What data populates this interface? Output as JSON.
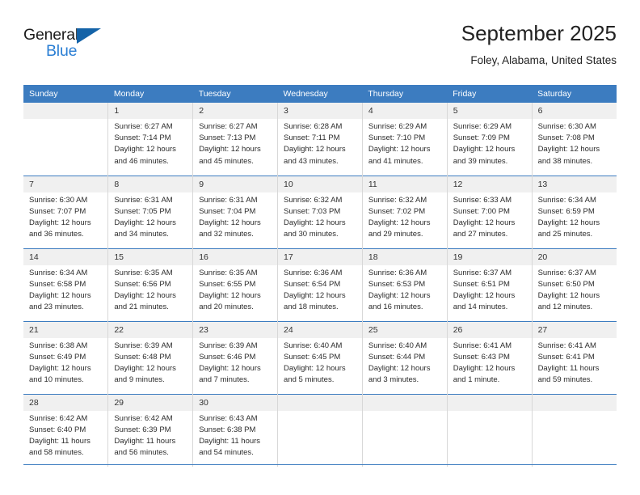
{
  "brand": {
    "name_top": "General",
    "name_bottom": "Blue",
    "logo_icon": "triangle-flag-icon",
    "color_dark": "#1b1b1b",
    "color_blue": "#2b7fd4",
    "color_triangle": "#1463a8"
  },
  "header": {
    "title": "September 2025",
    "subtitle": "Foley, Alabama, United States"
  },
  "theme": {
    "header_blue": "#3c7cc0",
    "daynum_band": "#f0f0f0",
    "text": "#2c2c2c"
  },
  "weekdays": [
    "Sunday",
    "Monday",
    "Tuesday",
    "Wednesday",
    "Thursday",
    "Friday",
    "Saturday"
  ],
  "weeks": [
    [
      {
        "day": "",
        "lines": []
      },
      {
        "day": "1",
        "lines": [
          "Sunrise: 6:27 AM",
          "Sunset: 7:14 PM",
          "Daylight: 12 hours",
          "and 46 minutes."
        ]
      },
      {
        "day": "2",
        "lines": [
          "Sunrise: 6:27 AM",
          "Sunset: 7:13 PM",
          "Daylight: 12 hours",
          "and 45 minutes."
        ]
      },
      {
        "day": "3",
        "lines": [
          "Sunrise: 6:28 AM",
          "Sunset: 7:11 PM",
          "Daylight: 12 hours",
          "and 43 minutes."
        ]
      },
      {
        "day": "4",
        "lines": [
          "Sunrise: 6:29 AM",
          "Sunset: 7:10 PM",
          "Daylight: 12 hours",
          "and 41 minutes."
        ]
      },
      {
        "day": "5",
        "lines": [
          "Sunrise: 6:29 AM",
          "Sunset: 7:09 PM",
          "Daylight: 12 hours",
          "and 39 minutes."
        ]
      },
      {
        "day": "6",
        "lines": [
          "Sunrise: 6:30 AM",
          "Sunset: 7:08 PM",
          "Daylight: 12 hours",
          "and 38 minutes."
        ]
      }
    ],
    [
      {
        "day": "7",
        "lines": [
          "Sunrise: 6:30 AM",
          "Sunset: 7:07 PM",
          "Daylight: 12 hours",
          "and 36 minutes."
        ]
      },
      {
        "day": "8",
        "lines": [
          "Sunrise: 6:31 AM",
          "Sunset: 7:05 PM",
          "Daylight: 12 hours",
          "and 34 minutes."
        ]
      },
      {
        "day": "9",
        "lines": [
          "Sunrise: 6:31 AM",
          "Sunset: 7:04 PM",
          "Daylight: 12 hours",
          "and 32 minutes."
        ]
      },
      {
        "day": "10",
        "lines": [
          "Sunrise: 6:32 AM",
          "Sunset: 7:03 PM",
          "Daylight: 12 hours",
          "and 30 minutes."
        ]
      },
      {
        "day": "11",
        "lines": [
          "Sunrise: 6:32 AM",
          "Sunset: 7:02 PM",
          "Daylight: 12 hours",
          "and 29 minutes."
        ]
      },
      {
        "day": "12",
        "lines": [
          "Sunrise: 6:33 AM",
          "Sunset: 7:00 PM",
          "Daylight: 12 hours",
          "and 27 minutes."
        ]
      },
      {
        "day": "13",
        "lines": [
          "Sunrise: 6:34 AM",
          "Sunset: 6:59 PM",
          "Daylight: 12 hours",
          "and 25 minutes."
        ]
      }
    ],
    [
      {
        "day": "14",
        "lines": [
          "Sunrise: 6:34 AM",
          "Sunset: 6:58 PM",
          "Daylight: 12 hours",
          "and 23 minutes."
        ]
      },
      {
        "day": "15",
        "lines": [
          "Sunrise: 6:35 AM",
          "Sunset: 6:56 PM",
          "Daylight: 12 hours",
          "and 21 minutes."
        ]
      },
      {
        "day": "16",
        "lines": [
          "Sunrise: 6:35 AM",
          "Sunset: 6:55 PM",
          "Daylight: 12 hours",
          "and 20 minutes."
        ]
      },
      {
        "day": "17",
        "lines": [
          "Sunrise: 6:36 AM",
          "Sunset: 6:54 PM",
          "Daylight: 12 hours",
          "and 18 minutes."
        ]
      },
      {
        "day": "18",
        "lines": [
          "Sunrise: 6:36 AM",
          "Sunset: 6:53 PM",
          "Daylight: 12 hours",
          "and 16 minutes."
        ]
      },
      {
        "day": "19",
        "lines": [
          "Sunrise: 6:37 AM",
          "Sunset: 6:51 PM",
          "Daylight: 12 hours",
          "and 14 minutes."
        ]
      },
      {
        "day": "20",
        "lines": [
          "Sunrise: 6:37 AM",
          "Sunset: 6:50 PM",
          "Daylight: 12 hours",
          "and 12 minutes."
        ]
      }
    ],
    [
      {
        "day": "21",
        "lines": [
          "Sunrise: 6:38 AM",
          "Sunset: 6:49 PM",
          "Daylight: 12 hours",
          "and 10 minutes."
        ]
      },
      {
        "day": "22",
        "lines": [
          "Sunrise: 6:39 AM",
          "Sunset: 6:48 PM",
          "Daylight: 12 hours",
          "and 9 minutes."
        ]
      },
      {
        "day": "23",
        "lines": [
          "Sunrise: 6:39 AM",
          "Sunset: 6:46 PM",
          "Daylight: 12 hours",
          "and 7 minutes."
        ]
      },
      {
        "day": "24",
        "lines": [
          "Sunrise: 6:40 AM",
          "Sunset: 6:45 PM",
          "Daylight: 12 hours",
          "and 5 minutes."
        ]
      },
      {
        "day": "25",
        "lines": [
          "Sunrise: 6:40 AM",
          "Sunset: 6:44 PM",
          "Daylight: 12 hours",
          "and 3 minutes."
        ]
      },
      {
        "day": "26",
        "lines": [
          "Sunrise: 6:41 AM",
          "Sunset: 6:43 PM",
          "Daylight: 12 hours",
          "and 1 minute."
        ]
      },
      {
        "day": "27",
        "lines": [
          "Sunrise: 6:41 AM",
          "Sunset: 6:41 PM",
          "Daylight: 11 hours",
          "and 59 minutes."
        ]
      }
    ],
    [
      {
        "day": "28",
        "lines": [
          "Sunrise: 6:42 AM",
          "Sunset: 6:40 PM",
          "Daylight: 11 hours",
          "and 58 minutes."
        ]
      },
      {
        "day": "29",
        "lines": [
          "Sunrise: 6:42 AM",
          "Sunset: 6:39 PM",
          "Daylight: 11 hours",
          "and 56 minutes."
        ]
      },
      {
        "day": "30",
        "lines": [
          "Sunrise: 6:43 AM",
          "Sunset: 6:38 PM",
          "Daylight: 11 hours",
          "and 54 minutes."
        ]
      },
      {
        "day": "",
        "lines": []
      },
      {
        "day": "",
        "lines": []
      },
      {
        "day": "",
        "lines": []
      },
      {
        "day": "",
        "lines": []
      }
    ]
  ]
}
